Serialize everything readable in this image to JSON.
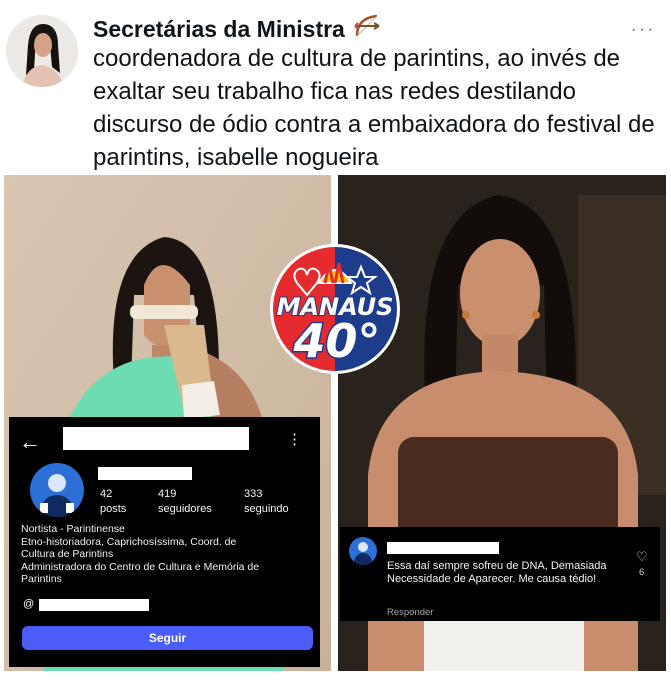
{
  "tweet": {
    "author": "Secretárias da Ministra",
    "author_emoji": "bow-and-arrow-icon",
    "text": "coordenadora de cultura de parintins, ao invés de exaltar seu trabalho fica nas redes destilando discurso de ódio contra a embaixadora do festival de parintins, isabelle nogueira",
    "more_icon": "···"
  },
  "logo": {
    "line1": "MANAUS",
    "line2": "40°",
    "colors": {
      "red": "#e52b2e",
      "blue": "#1d3c8c",
      "yellow": "#f7c600"
    }
  },
  "instagram_profile": {
    "back_icon": "←",
    "menu_icon": "⋮",
    "posts_count": "42",
    "posts_label": "posts",
    "followers_count": "419",
    "followers_label": "seguidores",
    "following_count": "333",
    "following_label": "seguindo",
    "bio_lines": [
      "Nortista - Parintinense",
      "Etno-historiadora, Caprichosíssima, Coord. de",
      "Cultura de Parintins",
      "Administradora do Centro de Cultura e Memória de",
      "Parintins"
    ],
    "threads_icon": "@",
    "follow_button": "Seguir",
    "follow_color": "#4a5df9"
  },
  "comment": {
    "text": "Essa daí sempre sofreu de DNA, Demasiada Necessidade de Aparecer. Me causa tédio!",
    "reply": "Responder",
    "heart_icon": "♡",
    "likes": "6"
  }
}
